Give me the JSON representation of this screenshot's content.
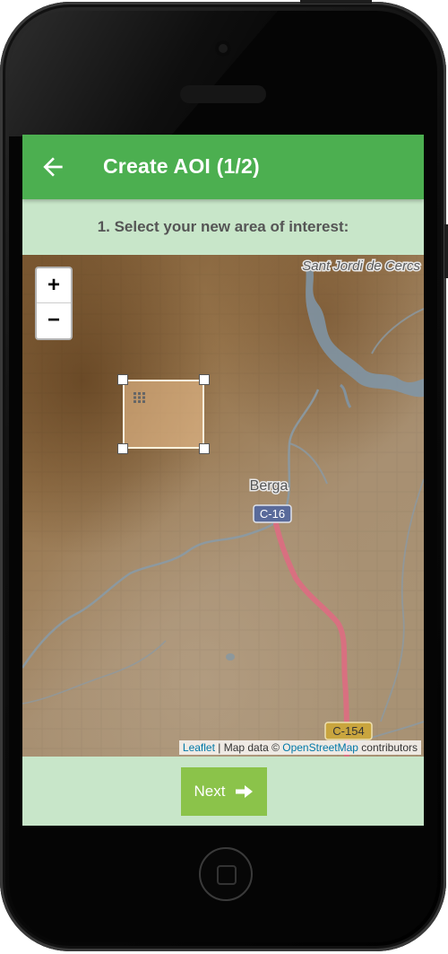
{
  "header": {
    "back_icon": "arrow-left-icon",
    "title": "Create AOI (1/2)",
    "color": "#4caf50"
  },
  "instruction": {
    "text": "1. Select your new area of interest:",
    "background": "#c8e6c9"
  },
  "map": {
    "zoom_in_label": "+",
    "zoom_out_label": "−",
    "place_labels": [
      "Sant Jordi de Cercs",
      "Berga"
    ],
    "road_labels": [
      "C-16",
      "C-154"
    ],
    "selection_move_icon": "drag-grid-icon",
    "attribution": {
      "leaflet": "Leaflet",
      "separator": " | Map data © ",
      "osm": "OpenStreetMap",
      "suffix": " contributors"
    }
  },
  "footer": {
    "next_label": "Next",
    "next_icon": "arrow-right-icon",
    "button_color": "#8bc34a"
  }
}
